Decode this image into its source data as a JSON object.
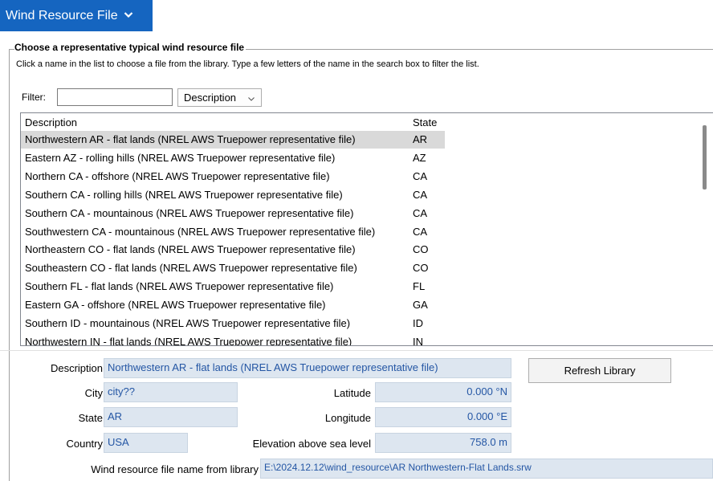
{
  "header": {
    "title": "Wind Resource File"
  },
  "group": {
    "title": "Choose a representative typical wind resource file",
    "description": "Click a name in the list to choose a file from the library. Type a few letters of the name in the search box to filter the list."
  },
  "filter": {
    "label": "Filter:",
    "value": "",
    "column": "Description"
  },
  "list": {
    "headers": {
      "description": "Description",
      "state": "State"
    },
    "rows": [
      {
        "description": "Northwestern AR - flat lands (NREL AWS Truepower representative file)",
        "state": "AR",
        "selected": true
      },
      {
        "description": "Eastern AZ - rolling hills (NREL AWS Truepower representative file)",
        "state": "AZ"
      },
      {
        "description": "Northern CA - offshore (NREL AWS Truepower representative file)",
        "state": "CA"
      },
      {
        "description": "Southern CA - rolling hills (NREL AWS Truepower representative file)",
        "state": "CA"
      },
      {
        "description": "Southern CA - mountainous (NREL AWS Truepower representative file)",
        "state": "CA"
      },
      {
        "description": "Southwestern CA - mountainous (NREL AWS Truepower representative file)",
        "state": "CA"
      },
      {
        "description": "Northeastern CO - flat lands (NREL AWS Truepower representative file)",
        "state": "CO"
      },
      {
        "description": "Southeastern CO - flat lands (NREL AWS Truepower representative file)",
        "state": "CO"
      },
      {
        "description": "Southern FL - flat lands (NREL AWS Truepower representative file)",
        "state": "FL"
      },
      {
        "description": "Eastern GA - offshore (NREL AWS Truepower representative file)",
        "state": "GA"
      },
      {
        "description": "Southern ID - mountainous (NREL AWS Truepower representative file)",
        "state": "ID"
      },
      {
        "description": "Northwestern IN - flat lands (NREL AWS Truepower representative file)",
        "state": "IN"
      }
    ]
  },
  "details": {
    "description_label": "Description",
    "description_value": "Northwestern AR - flat lands (NREL AWS Truepower representative file)",
    "city_label": "City",
    "city_value": "city??",
    "state_label": "State",
    "state_value": "AR",
    "country_label": "Country",
    "country_value": "USA",
    "latitude_label": "Latitude",
    "latitude_value": "0.000 °N",
    "longitude_label": "Longitude",
    "longitude_value": "0.000 °E",
    "elevation_label": "Elevation above sea level",
    "elevation_value": "758.0 m",
    "file_label": "Wind resource file name from library",
    "file_value": "E:\\2024.12.12\\wind_resource\\AR Northwestern-Flat Lands.srw"
  },
  "refresh_button": "Refresh Library",
  "colors": {
    "header_bg": "#1565c0",
    "field_bg": "#dde6f0",
    "field_text": "#2456a4",
    "selected_row": "#d9d9d9"
  }
}
